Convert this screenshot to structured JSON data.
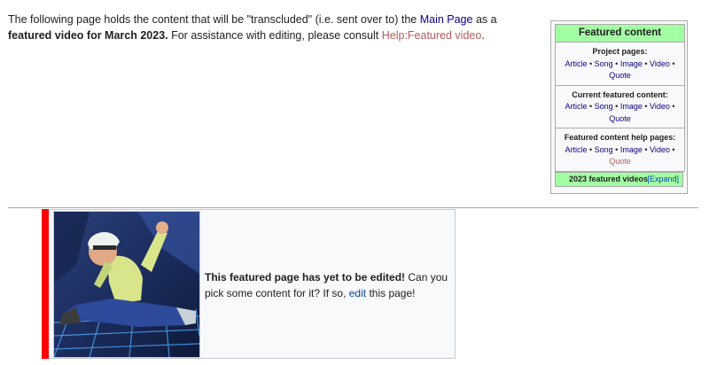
{
  "intro": {
    "text1": "The following page holds the content that will be \"transcluded\" (i.e. sent over to) the ",
    "main_page_link": "Main Page",
    "text2": " as a ",
    "bold": "featured video for March 2023.",
    "text3": " For assistance with editing, please consult ",
    "help_link": "Help:Featured video",
    "text4": "."
  },
  "navbox": {
    "title": "Featured content",
    "groups": [
      {
        "title": "Project pages:",
        "links": [
          "Article",
          "Song",
          "Image",
          "Video",
          "Quote"
        ]
      },
      {
        "title": "Current featured content:",
        "links": [
          "Article",
          "Song",
          "Image",
          "Video",
          "Quote"
        ]
      },
      {
        "title": "Featured content help pages:",
        "links": [
          "Article",
          "Song",
          "Image",
          "Video",
          "Quote"
        ]
      }
    ],
    "sep": " • ",
    "videos_title": "2023 featured videos",
    "expand_label": "[Expand]"
  },
  "feature": {
    "bold": "This featured page has yet to be edited!",
    "text1": " Can you pick some content for it? If so, ",
    "edit_link": "edit",
    "text2": " this page!"
  },
  "colors": {
    "accent_green": "#a3ffa3",
    "stripe_red": "#ff0000",
    "link": "#0b0080",
    "redlink": "#ba5a5a"
  }
}
